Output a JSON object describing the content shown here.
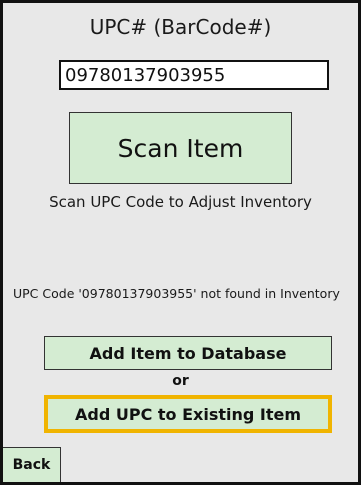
{
  "screen": {
    "upc_label": "UPC# (BarCode#)",
    "upc_value": "09780137903955",
    "scan_button_label": "Scan Item",
    "scan_hint": "Scan UPC Code to Adjust Inventory",
    "not_found_message": "UPC Code '09780137903955' not found in Inventory",
    "add_item_label": "Add Item to Database",
    "or_label": "or",
    "add_upc_label": "Add UPC to Existing Item",
    "back_label": "Back"
  },
  "colors": {
    "button_fill": "#d4ecd2",
    "background": "#e8e8e8",
    "highlight_border": "#f0b400"
  }
}
